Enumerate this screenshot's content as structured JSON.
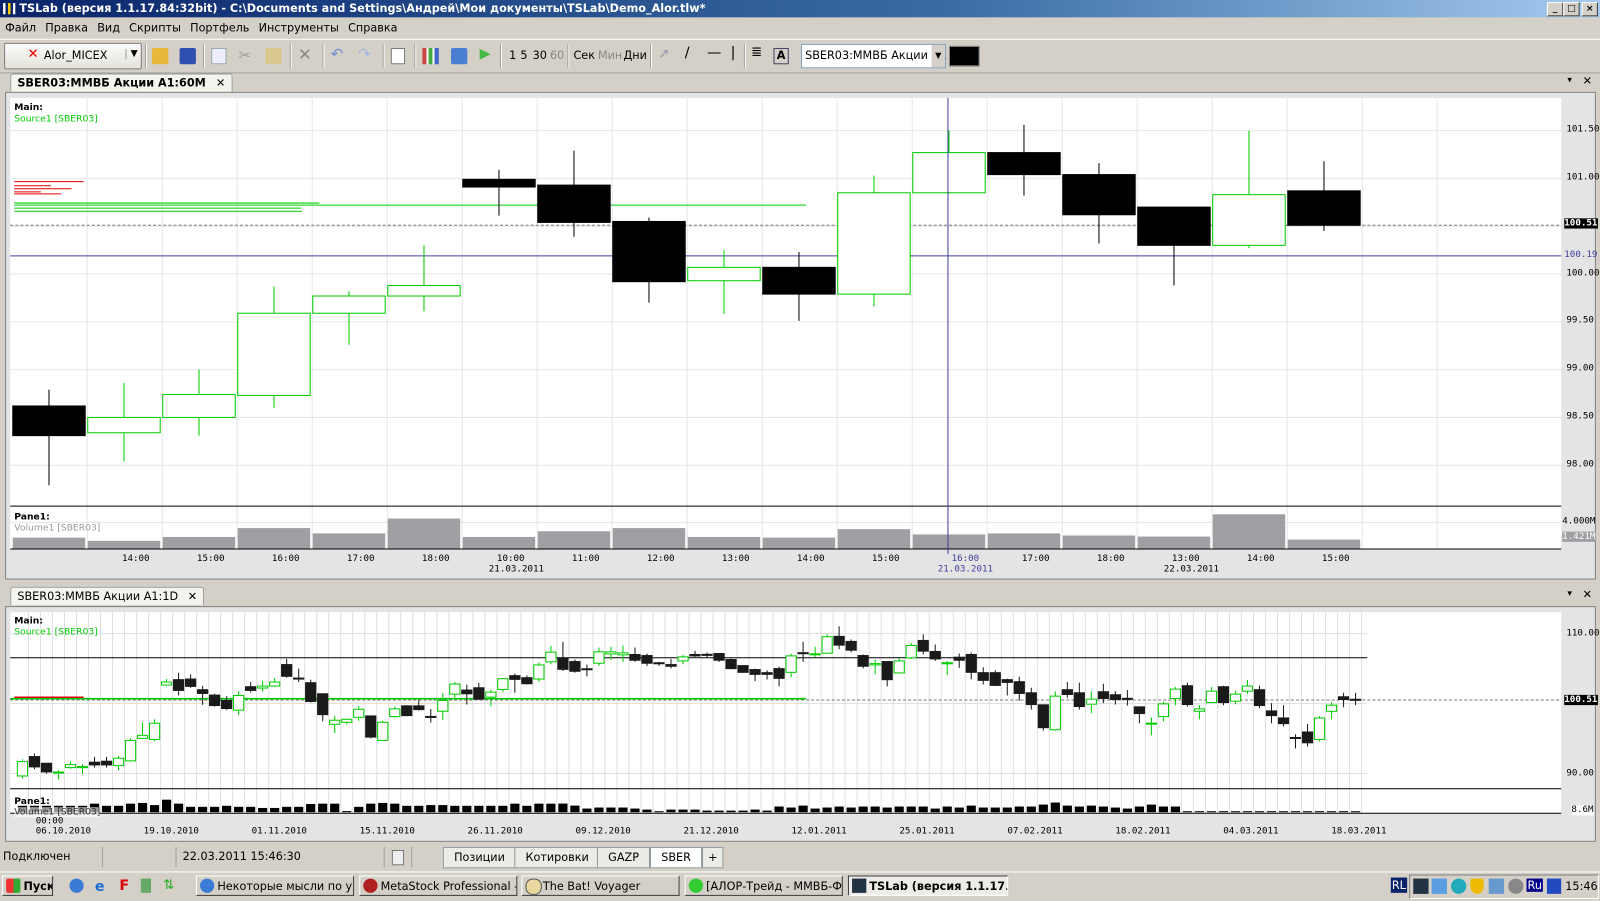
{
  "window": {
    "title": "TSLab (версия 1.1.17.84:32bit) - C:\\Documents and Settings\\Андрей\\Мои документы\\TSLab\\Demo_Alor.tlw*"
  },
  "menu": [
    "Файл",
    "Правка",
    "Вид",
    "Скрипты",
    "Портфель",
    "Инструменты",
    "Справка"
  ],
  "toolbar": {
    "account": "Alor_MICEX",
    "intervals": [
      "1",
      "5",
      "30",
      "60"
    ],
    "units": [
      "Сек",
      "Мин",
      "Дни"
    ],
    "symbol": "SBER03:ММВБ Акции А1"
  },
  "chart1": {
    "tab": "SBER03:ММВБ Акции А1:60M",
    "main_label": "Main:",
    "source_label": "Source1 [SBER03]",
    "pane_label": "Pane1:",
    "volume_label": "Volume1 [SBER03]",
    "price_ticks": [
      "101.50",
      "101.00",
      "100.00",
      "99.50",
      "99.00",
      "98.50",
      "98.00"
    ],
    "last_price": "100.51",
    "crosshair_price": "100.19",
    "volume_tick": "4.000M",
    "last_volume": "1.421M",
    "time_labels": [
      {
        "t": "14:00"
      },
      {
        "t": "15:00"
      },
      {
        "t": "16:00"
      },
      {
        "t": "17:00"
      },
      {
        "t": "18:00"
      },
      {
        "t": "10:00",
        "d": "21.03.2011"
      },
      {
        "t": "11:00"
      },
      {
        "t": "12:00"
      },
      {
        "t": "13:00"
      },
      {
        "t": "14:00"
      },
      {
        "t": "15:00"
      },
      {
        "t": "16:00"
      },
      {
        "t": "17:00"
      },
      {
        "t": "18:00"
      },
      {
        "t": "13:00",
        "d": "22.03.2011"
      },
      {
        "t": "14:00"
      },
      {
        "t": "15:00"
      }
    ],
    "crosshair_time": "16:00",
    "crosshair_date": "21.03.2011"
  },
  "chart2": {
    "tab": "SBER03:ММВБ Акции А1:1D",
    "main_label": "Main:",
    "source_label": "Source1 [SBER03]",
    "pane_label": "Pane1:",
    "volume_label": "Volume1 [SBER03]",
    "price_ticks": [
      "110.00",
      "90.00"
    ],
    "last_price": "100.51",
    "volume_tick": "8.6M",
    "first_time": "00:00",
    "date_labels": [
      "06.10.2010",
      "19.10.2010",
      "01.11.2010",
      "15.11.2010",
      "26.11.2010",
      "09.12.2010",
      "21.12.2010",
      "12.01.2011",
      "25.01.2011",
      "07.02.2011",
      "18.02.2011",
      "04.03.2011",
      "18.03.2011"
    ]
  },
  "status": {
    "connection": "Подключен",
    "datetime": "22.03.2011 15:46:30",
    "tabs": [
      "Позиции",
      "Котировки",
      "GAZP",
      "SBER",
      "+"
    ],
    "active_tab": "SBER"
  },
  "taskbar": {
    "start": "Пуск",
    "tasks": [
      "Некоторые мысли по у...",
      "MetaStock Professional -...",
      "The Bat! Voyager",
      "[АЛОР-Трейд - ММВБ-Ф...",
      "TSLab (версия 1.1.17..."
    ],
    "tray": [
      "RL",
      "Ru"
    ],
    "clock": "15:46"
  },
  "colors": {
    "up": "#00cc00",
    "down": "#000000",
    "volume": "#a09fa3",
    "crosshair": "#4040a0",
    "title_bar": "#0a246a"
  },
  "chart_data": [
    {
      "type": "candlestick",
      "title": "SBER03:ММВБ Акции А1:60M",
      "ylim": [
        97.7,
        101.65
      ],
      "volume_unit": "M",
      "ohlc": [
        [
          98.62,
          98.79,
          97.79,
          98.31
        ],
        [
          98.34,
          98.86,
          98.04,
          98.5
        ],
        [
          98.5,
          99.0,
          98.31,
          98.74
        ],
        [
          98.73,
          99.87,
          98.6,
          99.59
        ],
        [
          99.59,
          99.82,
          99.26,
          99.77
        ],
        [
          99.77,
          100.3,
          99.61,
          99.88
        ],
        [
          100.99,
          101.09,
          100.61,
          100.91
        ],
        [
          100.93,
          101.29,
          100.39,
          100.54
        ],
        [
          100.55,
          100.59,
          99.7,
          99.92
        ],
        [
          99.93,
          100.25,
          99.58,
          100.07
        ],
        [
          100.07,
          100.23,
          99.51,
          99.79
        ],
        [
          99.79,
          101.03,
          99.66,
          100.85
        ],
        [
          100.85,
          101.5,
          100.84,
          101.27
        ],
        [
          101.27,
          101.56,
          100.82,
          101.04
        ],
        [
          101.04,
          101.16,
          100.32,
          100.62
        ],
        [
          100.7,
          100.7,
          99.88,
          100.3
        ],
        [
          100.3,
          101.5,
          100.27,
          100.83
        ],
        [
          100.87,
          101.18,
          100.45,
          100.51
        ]
      ],
      "volume": [
        1.71,
        1.23,
        1.81,
        3.15,
        2.35,
        4.59,
        1.81,
        2.67,
        3.15,
        1.81,
        1.71,
        2.99,
        2.19,
        2.35,
        2.03,
        1.87,
        5.23,
        1.421
      ]
    },
    {
      "type": "candlestick",
      "title": "SBER03:ММВБ Акции А1:1D",
      "ylim": [
        88,
        111.5
      ],
      "volume_unit": "M",
      "ohlc": [
        [
          89.64,
          92.04,
          89.26,
          91.7
        ],
        [
          92.42,
          92.86,
          90.6,
          90.94
        ],
        [
          91.46,
          91.46,
          89.98,
          90.22
        ],
        [
          90.12,
          90.46,
          89.16,
          90.2
        ],
        [
          90.84,
          91.7,
          90.65,
          91.27
        ],
        [
          90.9,
          91.32,
          89.98,
          90.98
        ],
        [
          91.61,
          92.38,
          90.84,
          91.22
        ],
        [
          91.75,
          92.38,
          90.84,
          91.22
        ],
        [
          91.13,
          92.52,
          90.46,
          92.18
        ],
        [
          91.8,
          95.06,
          91.7,
          94.73
        ],
        [
          95.02,
          97.32,
          94.92,
          95.45
        ],
        [
          94.87,
          97.75,
          94.58,
          97.18
        ],
        [
          102.65,
          103.51,
          102.55,
          103.08
        ],
        [
          103.42,
          104.42,
          101.16,
          101.88
        ],
        [
          103.51,
          104.18,
          102.26,
          102.46
        ],
        [
          101.98,
          102.55,
          99.82,
          101.45
        ],
        [
          101.21,
          101.4,
          99.58,
          99.72
        ],
        [
          100.44,
          101.06,
          99.1,
          99.29
        ],
        [
          99.05,
          101.78,
          98.38,
          101.16
        ],
        [
          102.41,
          103.08,
          101.59,
          101.88
        ],
        [
          102.22,
          103.32,
          101.69,
          102.5
        ],
        [
          102.5,
          103.66,
          102.41,
          103.08
        ],
        [
          105.58,
          106.39,
          103.7,
          103.9
        ],
        [
          103.65,
          105.0,
          103.08,
          103.6
        ],
        [
          102.98,
          103.42,
          100.15,
          100.3
        ],
        [
          101.4,
          101.4,
          97.46,
          98.42
        ],
        [
          97.03,
          98.23,
          95.78,
          97.61
        ],
        [
          97.32,
          97.75,
          97.03,
          97.75
        ],
        [
          98.04,
          99.67,
          97.56,
          99.19
        ],
        [
          98.23,
          98.23,
          95.02,
          95.21
        ],
        [
          94.73,
          97.56,
          94.73,
          97.32
        ],
        [
          98.14,
          99.58,
          97.94,
          99.24
        ],
        [
          99.67,
          99.77,
          98.18,
          98.28
        ],
        [
          99.67,
          100.54,
          99.0,
          99.14
        ],
        [
          98.16,
          99.24,
          97.27,
          98.1
        ],
        [
          98.9,
          101.5,
          97.66,
          100.44
        ],
        [
          101.35,
          103.08,
          100.82,
          102.79
        ],
        [
          101.93,
          102.7,
          99.86,
          101.4
        ],
        [
          102.26,
          102.94,
          100.54,
          100.63
        ],
        [
          100.92,
          101.98,
          99.62,
          101.64
        ],
        [
          102.02,
          103.66,
          101.64,
          103.56
        ],
        [
          103.99,
          104.28,
          101.54,
          103.46
        ],
        [
          103.7,
          104.04,
          102.74,
          102.84
        ],
        [
          103.51,
          105.91,
          103.08,
          105.53
        ],
        [
          105.96,
          108.26,
          105.62,
          107.35
        ],
        [
          106.54,
          108.84,
          104.66,
          104.9
        ],
        [
          106.01,
          106.3,
          104.42,
          104.62
        ],
        [
          104.98,
          105.58,
          103.9,
          104.94
        ],
        [
          105.77,
          108.02,
          105.38,
          107.4
        ],
        [
          107.11,
          108.12,
          106.25,
          107.4
        ],
        [
          106.97,
          108.31,
          105.96,
          107.26
        ],
        [
          107.02,
          108.02,
          105.96,
          106.2
        ],
        [
          106.87,
          107.16,
          105.38,
          105.77
        ],
        [
          105.84,
          105.96,
          105.38,
          105.8
        ],
        [
          105.58,
          106.39,
          105.05,
          105.34
        ],
        [
          106.1,
          106.97,
          105.62,
          106.68
        ],
        [
          107.02,
          107.54,
          106.68,
          106.82
        ],
        [
          107.04,
          107.3,
          106.58,
          107.0
        ],
        [
          107.16,
          107.16,
          105.96,
          106.2
        ],
        [
          106.3,
          106.44,
          104.9,
          105.0
        ],
        [
          105.43,
          105.43,
          104.38,
          104.47
        ],
        [
          104.86,
          105.0,
          103.22,
          104.18
        ],
        [
          104.42,
          104.76,
          103.46,
          104.18
        ],
        [
          105.0,
          105.29,
          102.46,
          103.61
        ],
        [
          104.47,
          107.16,
          103.75,
          106.82
        ],
        [
          107.28,
          108.84,
          105.96,
          107.24
        ],
        [
          107.09,
          108.12,
          106.68,
          107.12
        ],
        [
          107.21,
          109.9,
          107.16,
          109.56
        ],
        [
          109.61,
          111.05,
          107.78,
          108.36
        ],
        [
          108.89,
          109.18,
          107.35,
          107.64
        ],
        [
          106.87,
          107.02,
          105.05,
          105.34
        ],
        [
          105.53,
          106.3,
          104.18,
          105.72
        ],
        [
          106.01,
          106.01,
          102.46,
          103.42
        ],
        [
          104.38,
          106.49,
          104.38,
          106.1
        ],
        [
          106.54,
          108.7,
          106.39,
          108.31
        ],
        [
          109.03,
          109.9,
          107.06,
          107.5
        ],
        [
          107.45,
          108.46,
          106.1,
          106.39
        ],
        [
          105.8,
          106.1,
          104.09,
          105.84
        ],
        [
          106.63,
          107.16,
          105.1,
          106.2
        ],
        [
          107.02,
          107.3,
          103.46,
          104.47
        ],
        [
          104.42,
          105.19,
          102.74,
          103.32
        ],
        [
          104.42,
          104.76,
          102.5,
          102.6
        ],
        [
          103.42,
          103.56,
          101.16,
          103.03
        ],
        [
          103.13,
          103.85,
          100.44,
          101.45
        ],
        [
          101.54,
          102.26,
          99.14,
          99.86
        ],
        [
          99.82,
          99.82,
          96.12,
          96.55
        ],
        [
          96.26,
          101.74,
          96.12,
          101.06
        ],
        [
          101.98,
          103.08,
          100.82,
          101.3
        ],
        [
          101.54,
          102.98,
          99.14,
          99.58
        ],
        [
          99.91,
          101.78,
          98.62,
          100.63
        ],
        [
          101.69,
          102.84,
          100.06,
          100.73
        ],
        [
          101.26,
          101.78,
          99.86,
          100.58
        ],
        [
          100.75,
          101.93,
          99.72,
          100.7
        ],
        [
          99.53,
          99.53,
          97.18,
          98.57
        ],
        [
          97.16,
          98.04,
          95.45,
          97.2
        ],
        [
          98.14,
          100.25,
          97.46,
          99.96
        ],
        [
          100.73,
          102.36,
          99.77,
          102.07
        ],
        [
          102.55,
          102.98,
          99.58,
          99.86
        ],
        [
          98.9,
          99.77,
          97.75,
          99.24
        ],
        [
          100.15,
          102.36,
          100.06,
          101.78
        ],
        [
          102.41,
          102.55,
          99.77,
          100.15
        ],
        [
          100.34,
          101.78,
          99.91,
          101.35
        ],
        [
          101.78,
          103.37,
          101.4,
          102.5
        ],
        [
          101.98,
          102.55,
          99.34,
          99.72
        ],
        [
          98.95,
          100.06,
          97.18,
          98.28
        ],
        [
          97.94,
          99.77,
          96.74,
          97.13
        ],
        [
          95.15,
          95.59,
          93.58,
          95.11
        ],
        [
          95.93,
          97.08,
          93.86,
          94.39
        ],
        [
          94.87,
          98.23,
          94.58,
          97.94
        ],
        [
          98.9,
          100.2,
          97.75,
          99.77
        ],
        [
          100.97,
          101.54,
          99.48,
          100.58
        ],
        [
          100.61,
          101.54,
          99.77,
          100.51
        ]
      ],
      "volume": [
        6.3,
        6.3,
        6.3,
        6.3,
        6.3,
        6.3,
        8.4,
        6.3,
        6.3,
        8.4,
        9.1,
        7.0,
        12.3,
        8.4,
        5.3,
        5.3,
        5.3,
        6.3,
        5.3,
        5.3,
        4.2,
        4.2,
        5.3,
        5.3,
        8.1,
        8.4,
        8.4,
        1.1,
        5.3,
        8.4,
        9.1,
        8.4,
        6.3,
        6.3,
        7.0,
        7.0,
        6.3,
        6.3,
        6.3,
        6.3,
        6.3,
        8.4,
        6.3,
        8.4,
        8.4,
        8.5,
        6.5,
        3.6,
        4.6,
        4.6,
        4.6,
        3.6,
        2.6,
        0.7,
        2.6,
        2.6,
        2.6,
        1.6,
        1.6,
        1.6,
        1.6,
        2.6,
        1.6,
        5.6,
        4.6,
        6.5,
        3.6,
        4.6,
        5.6,
        4.6,
        5.6,
        5.6,
        4.6,
        5.6,
        5.6,
        5.6,
        3.6,
        5.6,
        4.6,
        6.5,
        4.6,
        4.6,
        4.6,
        5.6,
        5.6,
        7.5,
        9.5,
        6.5,
        5.6,
        6.5,
        5.6,
        4.6,
        3.6,
        5.6,
        7.5,
        5.6,
        5.6,
        0.3,
        0.3,
        0.3,
        0.3,
        0.3,
        0.3,
        0.3,
        0.3,
        0.3,
        0.3,
        0.3,
        0.3,
        0.3,
        0.3,
        0.3
      ]
    }
  ]
}
